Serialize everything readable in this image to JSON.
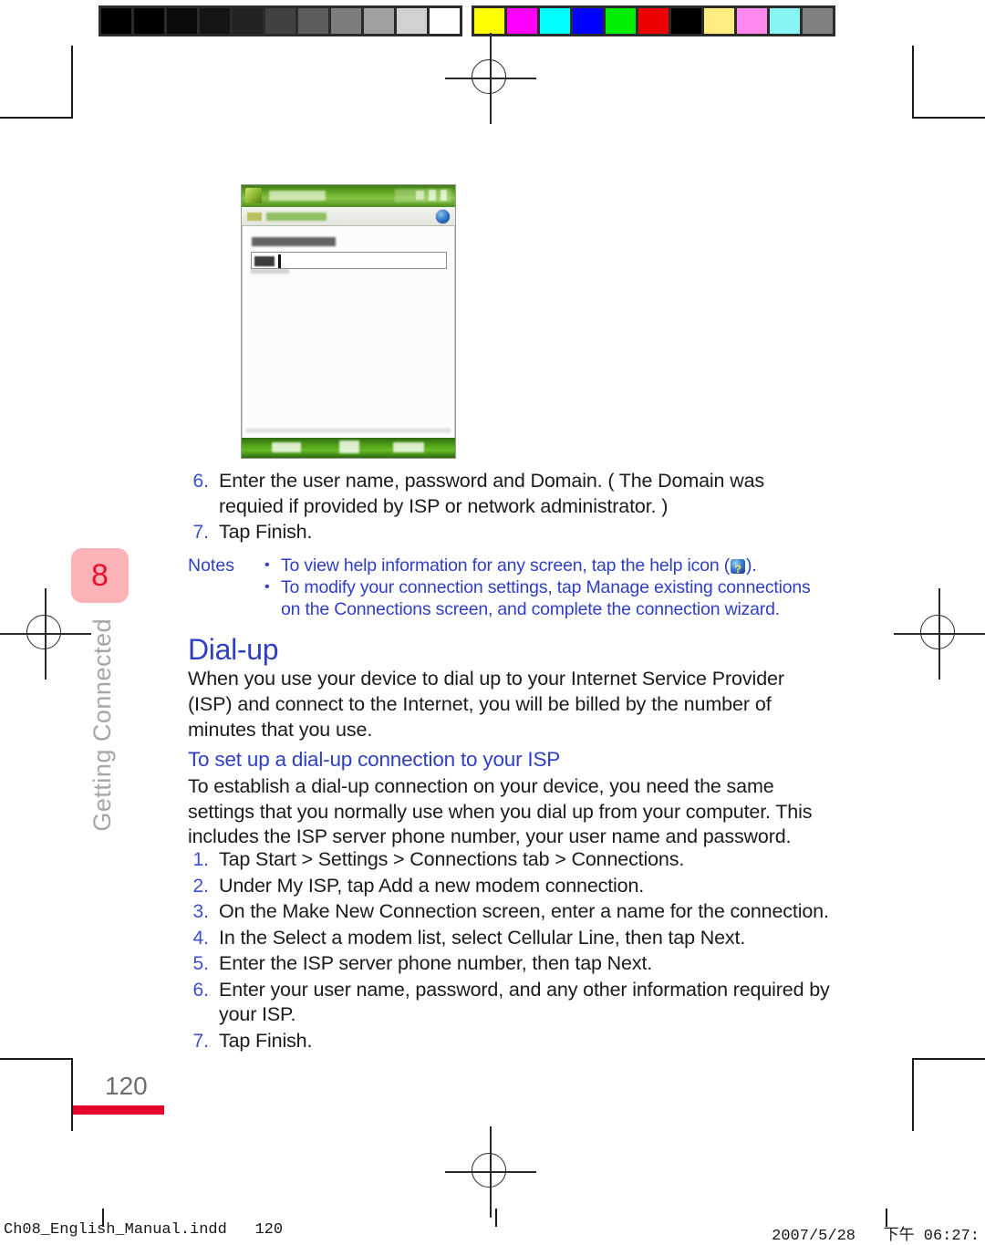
{
  "calibration": {
    "grayscale_swatches": [
      "#000000",
      "#000000",
      "#0a0a0a",
      "#141414",
      "#232323",
      "#414141",
      "#5c5c5c",
      "#7d7d7d",
      "#a0a0a0",
      "#d1d1d1",
      "#ffffff"
    ],
    "color_swatches": [
      "#ffff00",
      "#ff00ff",
      "#00ffff",
      "#0000ff",
      "#00ee00",
      "#ee0000",
      "#000000",
      "#ffee7f",
      "#ff88ee",
      "#88f5f5",
      "#808080"
    ]
  },
  "chapter": {
    "number": "8",
    "title": "Getting Connected",
    "tab_color": "#fcb3b8",
    "number_color": "#e8112d",
    "title_color": "#a6a6a6"
  },
  "page": {
    "number": "120",
    "rule_color": "#e4002b"
  },
  "screenshot": {
    "alt_name": "pocket-pc-access-point-name-screen"
  },
  "top_steps": [
    {
      "marker": "6.",
      "text": "Enter the user name, password and Domain. ( The Domain was requied if provided by ISP or network administrator. )"
    },
    {
      "marker": "7.",
      "text": "Tap Finish."
    }
  ],
  "notes": {
    "label": "Notes",
    "bullet": "•",
    "items": [
      {
        "before": "To view help information for any screen, tap the help icon (",
        "icon": "help-globe-icon",
        "after": ")."
      },
      {
        "before": "To modify your connection settings, tap Manage existing connections on the Connections screen, and complete the connection wizard.",
        "icon": null,
        "after": ""
      }
    ],
    "color": "#2f3fc4"
  },
  "dialup": {
    "heading": "Dial-up",
    "paragraph": "When you use your device to dial up to your Internet Service Provider (ISP) and connect to the Internet, you will be billed by the number of minutes that you use.",
    "subheading": "To set up a dial-up connection to your ISP",
    "sub_paragraph": "To establish a dial-up connection on your device, you need the same settings that you normally use when you dial up from your computer. This includes the ISP server phone number, your user name and password.",
    "heading_color": "#2f3fc4"
  },
  "steps": [
    {
      "marker": "1.",
      "text": "Tap Start > Settings > Connections tab > Connections."
    },
    {
      "marker": "2.",
      "text": "Under My ISP, tap Add a new modem connection."
    },
    {
      "marker": "3.",
      "text": "On the Make New Connection screen, enter a name for the connection."
    },
    {
      "marker": "4.",
      "text": "In the Select a modem list, select Cellular Line, then tap Next."
    },
    {
      "marker": "5.",
      "text": "Enter the ISP server phone number, then tap Next."
    },
    {
      "marker": "6.",
      "text": "Enter your user name, password, and any other information required by your ISP."
    },
    {
      "marker": "7.",
      "text": "Tap Finish."
    }
  ],
  "footer": {
    "left": "Ch08_English_Manual.indd   120",
    "right": "2007/5/28   下午 06:27:"
  }
}
